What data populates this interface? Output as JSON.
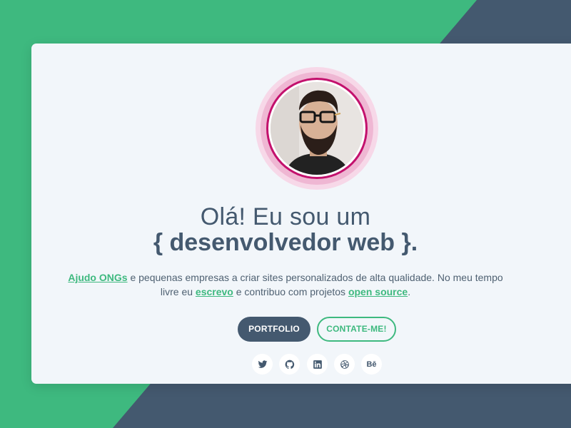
{
  "hero": {
    "greeting": "Olá! Eu sou um",
    "role": "{ desenvolvedor web }.",
    "desc": {
      "link1": "Ajudo ONGs",
      "text1": " e pequenas empresas a criar sites personalizados de alta qualidade. No meu tempo livre eu ",
      "link2": "escrevo",
      "text2": " e contribuo com projetos ",
      "link3": "open source",
      "text3": "."
    }
  },
  "buttons": {
    "portfolio": "PORTFOLIO",
    "contact": "CONTATE-ME!"
  },
  "social": {
    "behance": "Bē"
  },
  "icons": [
    "twitter-icon",
    "github-icon",
    "linkedin-icon",
    "dribbble-icon",
    "behance-icon"
  ],
  "colors": {
    "green": "#3eb97f",
    "navy": "#44596f",
    "magenta": "#c3116d",
    "card": "#f2f6fa"
  }
}
